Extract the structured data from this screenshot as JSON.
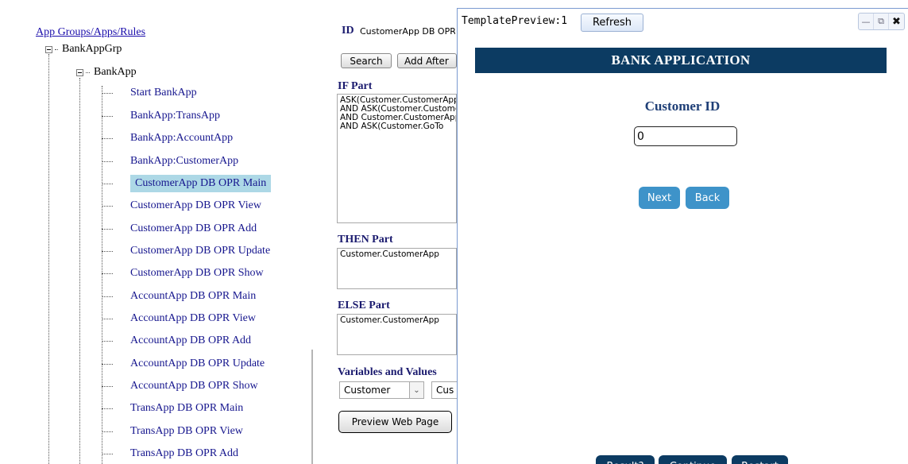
{
  "tree": {
    "root_link": "App Groups/Apps/Rules",
    "group": "BankAppGrp",
    "app": "BankApp",
    "items": [
      {
        "label": "Start BankApp"
      },
      {
        "label": "BankApp:TransApp"
      },
      {
        "label": "BankApp:AccountApp"
      },
      {
        "label": "BankApp:CustomerApp"
      },
      {
        "label": "CustomerApp DB OPR Main",
        "selected": true
      },
      {
        "label": "CustomerApp DB OPR View"
      },
      {
        "label": "CustomerApp DB OPR Add"
      },
      {
        "label": "CustomerApp DB OPR Update"
      },
      {
        "label": "CustomerApp DB OPR Show"
      },
      {
        "label": "AccountApp DB OPR Main"
      },
      {
        "label": "AccountApp DB OPR View"
      },
      {
        "label": "AccountApp DB OPR Add"
      },
      {
        "label": "AccountApp DB OPR Update"
      },
      {
        "label": "AccountApp DB OPR Show"
      },
      {
        "label": "TransApp DB OPR Main"
      },
      {
        "label": "TransApp DB OPR View"
      },
      {
        "label": "TransApp DB OPR Add"
      }
    ]
  },
  "rule": {
    "id_label": "ID",
    "id_value": "CustomerApp DB OPR Main",
    "search_label": "Search",
    "add_after_label": "Add After",
    "if_label": "IF Part",
    "if_text": "ASK(Customer.CustomerApp\nAND ASK(Customer.Customer\nAND Customer.CustomerApp\nAND ASK(Customer.GoTo",
    "then_label": "THEN Part",
    "then_text": "Customer.CustomerApp",
    "else_label": "ELSE Part",
    "else_text": "Customer.CustomerApp",
    "vars_label": "Variables and Values",
    "var_select": "Customer",
    "var_select2": "Cus",
    "preview_label": "Preview Web Page"
  },
  "preview": {
    "title": "TemplatePreview:1",
    "refresh_label": "Refresh",
    "minimize_glyph": "—",
    "popout_glyph": "⧉",
    "close_glyph": "✖",
    "header": "BANK APPLICATION",
    "customer_id_label": "Customer ID",
    "customer_id_value": "0",
    "next_label": "Next",
    "back_label": "Back",
    "result_label": "Result?",
    "continue_label": "Continue",
    "restart_label": "Restart"
  }
}
